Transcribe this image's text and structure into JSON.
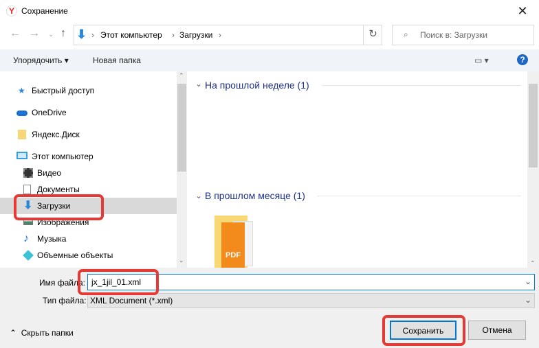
{
  "window": {
    "title": "Сохранение",
    "logo": "Y",
    "close": "✕"
  },
  "address": {
    "path": [
      "Этот компьютер",
      "Загрузки"
    ],
    "search_placeholder": "Поиск в: Загрузки"
  },
  "toolbar": {
    "organize": "Упорядочить",
    "new_folder": "Новая папка",
    "help": "?"
  },
  "sidebar": {
    "items": [
      {
        "label": "Быстрый доступ",
        "icon": "star-icon"
      },
      {
        "label": "OneDrive",
        "icon": "cloud-icon"
      },
      {
        "label": "Яндекс.Диск",
        "icon": "yandex-disk-icon"
      },
      {
        "label": "Этот компьютер",
        "icon": "computer-icon"
      },
      {
        "label": "Видео",
        "icon": "video-icon"
      },
      {
        "label": "Документы",
        "icon": "document-icon"
      },
      {
        "label": "Загрузки",
        "icon": "download-icon",
        "selected": true
      },
      {
        "label": "Изображения",
        "icon": "image-icon"
      },
      {
        "label": "Музыка",
        "icon": "music-icon"
      },
      {
        "label": "Объемные объекты",
        "icon": "3d-objects-icon"
      }
    ]
  },
  "content": {
    "groups": [
      {
        "label": "На прошлой неделе (1)"
      },
      {
        "label": "В прошлом месяце (1)"
      }
    ],
    "file_icon_label": "PDF"
  },
  "form": {
    "filename_label": "Имя файла:",
    "filename": "jx_1jil_01.xml",
    "type_label": "Тип файла:",
    "type": "XML Document (*.xml)"
  },
  "footer": {
    "hide_folders": "Скрыть папки",
    "save": "Сохранить",
    "cancel": "Отмена"
  },
  "colors": {
    "highlight": "#e53935",
    "accent": "#0078d7"
  }
}
